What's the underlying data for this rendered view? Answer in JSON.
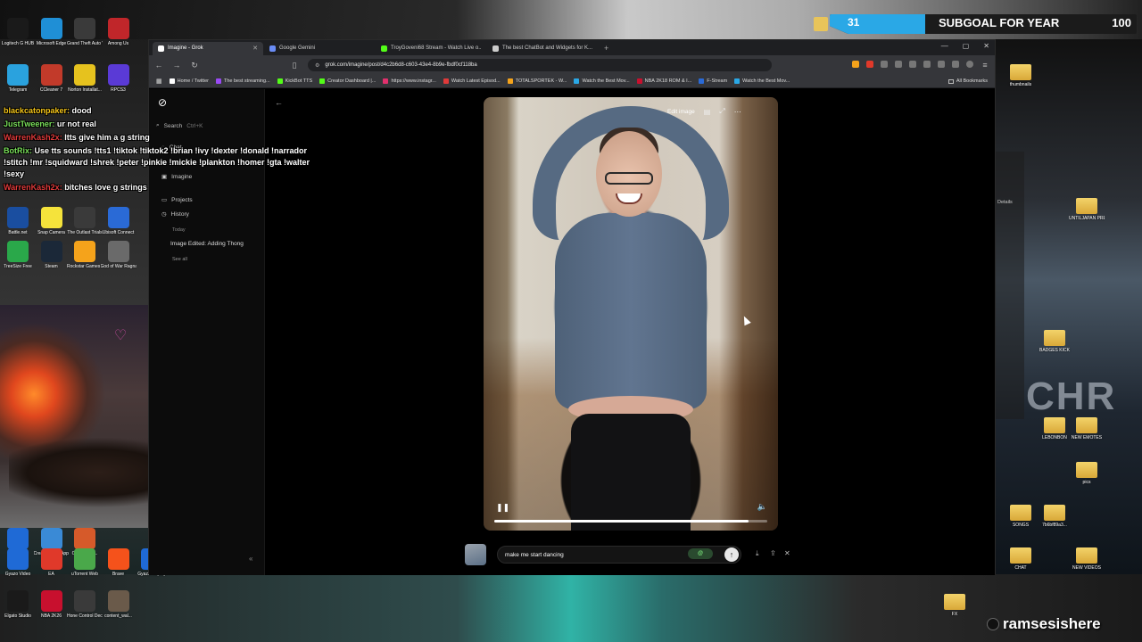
{
  "desktop": {
    "left_icons": [
      {
        "label": "Logitech G HUB",
        "color": "#1a1a1a"
      },
      {
        "label": "Microsoft Edge",
        "color": "#1f8fd6"
      },
      {
        "label": "Grand Theft Auto V",
        "color": "#3a3a3a"
      },
      {
        "label": "Among Us",
        "color": "#c0262a"
      },
      {
        "label": "Telegram",
        "color": "#2aa2de"
      },
      {
        "label": "CCleaner 7",
        "color": "#c23a2a"
      },
      {
        "label": "Norton Installat...",
        "color": "#e6c21e"
      },
      {
        "label": "RPCS3",
        "color": "#5a3ad6"
      },
      {
        "label": "Battle.net",
        "color": "#1a4ea0"
      },
      {
        "label": "Snap Camera",
        "color": "#f5e33b"
      },
      {
        "label": "The Outlast Trials",
        "color": "#3a3a3a"
      },
      {
        "label": "Ubisoft Connect",
        "color": "#2a6ad6"
      },
      {
        "label": "TreeSize Free",
        "color": "#2aa84a"
      },
      {
        "label": "Steam",
        "color": "#1b2838"
      },
      {
        "label": "Rockstar Games ...",
        "color": "#f5a31b"
      },
      {
        "label": "God of War Ragnarok",
        "color": "#6a6a6a"
      },
      {
        "label": "Gyazo",
        "color": "#1f6ad6"
      },
      {
        "label": "Create React App Sample",
        "color": "#3a8ad6"
      },
      {
        "label": "ClownfishV...",
        "color": "#d65a2a"
      },
      {
        "label": "Gyazo Video",
        "color": "#1f6ad6"
      },
      {
        "label": "EA",
        "color": "#e0392a"
      },
      {
        "label": "uTorrent Web",
        "color": "#4aa84a"
      },
      {
        "label": "Brave",
        "color": "#f5521b"
      },
      {
        "label": "Gyazo Replay",
        "color": "#1f6ad6"
      },
      {
        "label": "Elgato Studio",
        "color": "#1a1a1a"
      },
      {
        "label": "NBA 2K26",
        "color": "#c8102e"
      },
      {
        "label": "Hone Control Deck.exe",
        "color": "#3a3a3a"
      },
      {
        "label": "content_wal...",
        "color": "#6a5a4a"
      }
    ],
    "right_icons": [
      {
        "label": "thumbnails"
      },
      {
        "label": "UNTILJAPAN PRESET PA..."
      },
      {
        "label": "BADGES KICK"
      },
      {
        "label": "LEBONBON"
      },
      {
        "label": "NEW EMOTES"
      },
      {
        "label": "pics"
      },
      {
        "label": "SONGS"
      },
      {
        "label": "7b6bf89a3..."
      },
      {
        "label": "CHAT"
      },
      {
        "label": "NEW VIDEOS"
      },
      {
        "label": "FX"
      }
    ],
    "explorer_details": "Details",
    "court_text": "CHR"
  },
  "chat": [
    {
      "user": "blackcatonpaker:",
      "user_color": "#f5c518",
      "message": "dood"
    },
    {
      "user": "JustTweener:",
      "user_color": "#7ae05a",
      "message": "ur not real"
    },
    {
      "user": "WarrenKash2x:",
      "user_color": "#e03a3a",
      "message": "Itts give him a g string"
    },
    {
      "user": "BotRix:",
      "user_color": "#7ae05a",
      "message": "Use tts sounds !tts1 !tiktok !tiktok2 !brian !ivy !dexter !donald !narrador !stitch !mr !squidward !shrek !peter !pinkie !mickie !plankton !homer !gta !walter !sexy"
    },
    {
      "user": "WarrenKash2x:",
      "user_color": "#e03a3a",
      "message": "bitches love g strings"
    }
  ],
  "subgoal": {
    "count": "31",
    "label": "SUBGOAL FOR YEAR",
    "target": "100",
    "progress": 0.31,
    "fill_color": "#2aa8e6"
  },
  "watermark": "ramsesishere",
  "browser": {
    "tabs": [
      {
        "title": "Imagine - Grok",
        "active": true,
        "fav_color": "#ffffff"
      },
      {
        "title": "Google Gemini",
        "active": false,
        "fav_color": "#6a8cf5"
      },
      {
        "title": "TroyGoveni68 Stream - Watch Live o...",
        "active": false,
        "fav_color": "#53fc18"
      },
      {
        "title": "The best ChatBot and Widgets for K...",
        "active": false,
        "fav_color": "#cccccc"
      }
    ],
    "new_tab": "+",
    "url": "grok.com/imagine/post/d4c2b6d8-c603-43e4-8b9e-fbdf0cf118ba",
    "bookmarks": [
      {
        "label": "Home / Twitter",
        "color": "#ffffff"
      },
      {
        "label": "The best streaming...",
        "color": "#9a4af5"
      },
      {
        "label": "KickBot TTS",
        "color": "#53fc18"
      },
      {
        "label": "Creator Dashboard |...",
        "color": "#53fc18"
      },
      {
        "label": "https://www.instagr...",
        "color": "#e1306c"
      },
      {
        "label": "Watch Latest Episod...",
        "color": "#e03a3a"
      },
      {
        "label": "TOTALSPORTEK - W...",
        "color": "#f5a31b"
      },
      {
        "label": "Watch the Best Mov...",
        "color": "#2aa8e6"
      },
      {
        "label": "NBA 2K18 ROM & I...",
        "color": "#c8102e"
      },
      {
        "label": "F-Stream",
        "color": "#2a6ad6"
      },
      {
        "label": "Watch the Best Mov...",
        "color": "#2aa8e6"
      }
    ],
    "all_bookmarks": "All Bookmarks"
  },
  "grok": {
    "search_label": "Search",
    "search_shortcut": "Ctrl+K",
    "sidebar_items": [
      {
        "label": "Chat",
        "icon": "chat-icon"
      },
      {
        "label": "Imagine",
        "icon": "image-icon"
      },
      {
        "label": "Projects",
        "icon": "folder-icon"
      },
      {
        "label": "History",
        "icon": "history-icon"
      }
    ],
    "today_label": "Today",
    "history_item": "Image Edited: Adding Thong",
    "see_all": "See all",
    "edit_image": "Edit image",
    "video_progress": 0.93,
    "prompt_value": "make me start dancing",
    "prompt_badge": "@"
  }
}
